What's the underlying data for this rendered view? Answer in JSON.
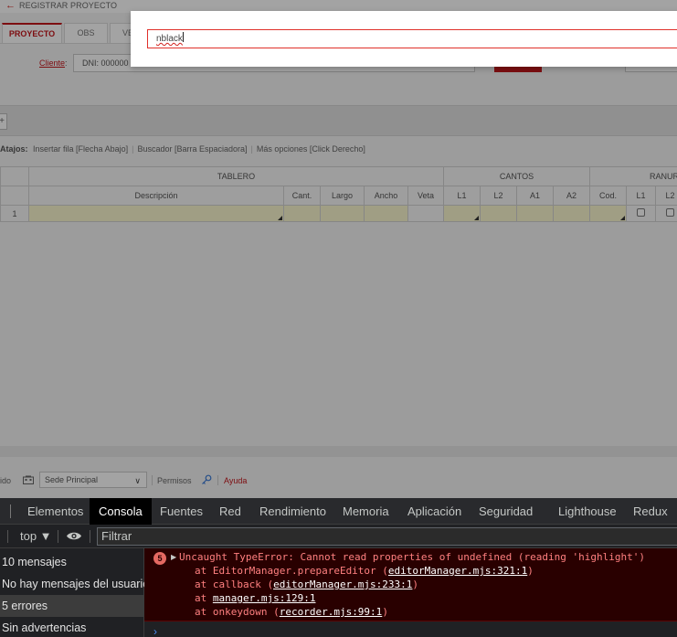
{
  "app": {
    "page_title": "REGISTRAR PROYECTO",
    "tabs": [
      {
        "label": "PROYECTO"
      },
      {
        "label": "OBS"
      },
      {
        "label": "VE"
      }
    ],
    "cliente_label": "Cliente",
    "cliente_colon": ":",
    "cliente_value": "DNI: 000000",
    "add_row_symbol": "+",
    "shortcuts": {
      "label": "Atajos:",
      "items": [
        "Insertar fila [Flecha Abajo]",
        "Buscador [Barra Espaciadora]",
        "Más opciones [Click Derecho]"
      ]
    },
    "grid": {
      "groups": [
        "TABLERO",
        "CANTOS",
        "RANUR"
      ],
      "columns": [
        "Descripción",
        "Cant.",
        "Largo",
        "Ancho",
        "Veta",
        "L1",
        "L2",
        "A1",
        "A2",
        "Cod.",
        "L1",
        "L2"
      ],
      "rows": [
        {
          "num": "1"
        }
      ]
    },
    "status": {
      "fragment": "ido",
      "sede": "Sede Principal",
      "permisos": "Permisos",
      "ayuda": "Ayuda"
    },
    "colors": {
      "accent": "#c4161c"
    }
  },
  "modal": {
    "search_value": "nblack"
  },
  "devtools": {
    "tabs": [
      "Elementos",
      "Consola",
      "Fuentes",
      "Red",
      "Rendimiento",
      "Memoria",
      "Aplicación",
      "Seguridad",
      "Lighthouse",
      "Redux"
    ],
    "active_tab": "Consola",
    "context": "top ▼",
    "filter_placeholder": "Filtrar",
    "sidebar": [
      "10 mensajes",
      "No hay mensajes del usuario",
      "5 errores",
      "Sin advertencias"
    ],
    "error": {
      "count": "5",
      "message": "Uncaught TypeError: Cannot read properties of undefined (reading 'highlight')",
      "stack": [
        {
          "prefix": "at EditorManager.prepareEditor (",
          "link": "editorManager.mjs:321:1",
          "suffix": ")"
        },
        {
          "prefix": "at callback (",
          "link": "editorManager.mjs:233:1",
          "suffix": ")"
        },
        {
          "prefix": "at ",
          "link": "manager.mjs:129:1",
          "suffix": ""
        },
        {
          "prefix": "at onkeydown (",
          "link": "recorder.mjs:99:1",
          "suffix": ")"
        }
      ]
    },
    "prompt_symbol": "›"
  }
}
